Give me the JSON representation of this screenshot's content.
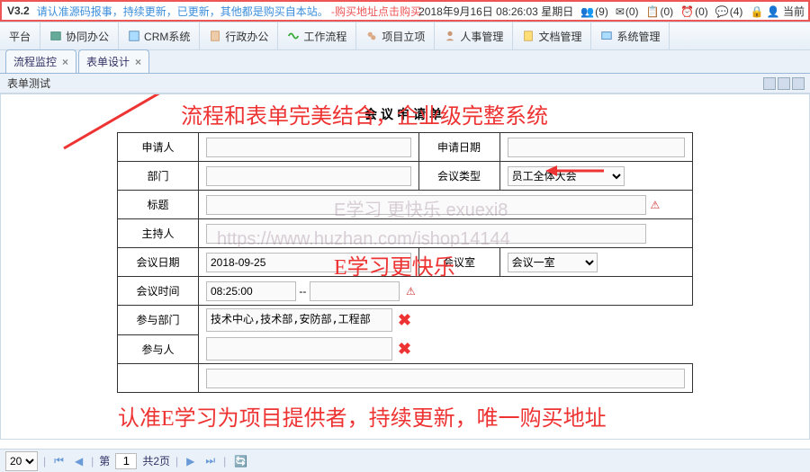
{
  "top": {
    "version": "V3.2",
    "notice_pre": "请认准源码报事，持续更新，已更新，其他都是购买自本站。",
    "notice_link": "-购买地址点击购买",
    "datetime": "2018年9月16日 08:26:03 星期日",
    "badges": [
      {
        "icon": "👥",
        "n": "(9)"
      },
      {
        "icon": "✉",
        "n": "(0)"
      },
      {
        "icon": "📋",
        "n": "(0)"
      },
      {
        "icon": "⏰",
        "n": "(0)"
      },
      {
        "icon": "💬",
        "n": "(4)"
      }
    ],
    "tail": "🔒 👤 当前"
  },
  "menu": [
    "平台",
    "协同办公",
    "CRM系统",
    "行政办公",
    "工作流程",
    "项目立项",
    "人事管理",
    "文档管理",
    "系统管理"
  ],
  "tabs": [
    {
      "label": "流程监控",
      "closable": true
    },
    {
      "label": "表单设计",
      "closable": true
    }
  ],
  "subhead": "表单测试",
  "form": {
    "title": "会议申请单",
    "r1a": "申请人",
    "r1b": "申请日期",
    "r2a": "部门",
    "r2b": "会议类型",
    "r2b_sel": "员工全体大会",
    "r3": "标题",
    "r4": "主持人",
    "r5a": "会议日期",
    "r5a_val": "2018-09-25",
    "r5b": "会议室",
    "r5b_sel": "会议一室",
    "r6": "会议时间",
    "r6_val": "08:25:00",
    "r6_sep": "--",
    "r7": "参与部门",
    "r7_val": "技术中心,技术部,安防部,工程部",
    "r8": "参与人"
  },
  "anno": {
    "a1": "流程和表单完美结合，企业级完整系统",
    "a2": "E学习更快乐",
    "a3": "认准E学习为项目提供者，持续更新，唯一购买地址"
  },
  "wm": {
    "w1": "E学习 更快乐 exuexi8",
    "w2": "https://www.huzhan.com/ishop14144"
  },
  "footer": {
    "pagesize": "20",
    "page": "1",
    "total_lbl": "共2页",
    "first": "⏮",
    "prev": "◀",
    "next": "▶",
    "last": "⏭",
    "refresh": "🔄",
    "page_lbl": "第"
  }
}
